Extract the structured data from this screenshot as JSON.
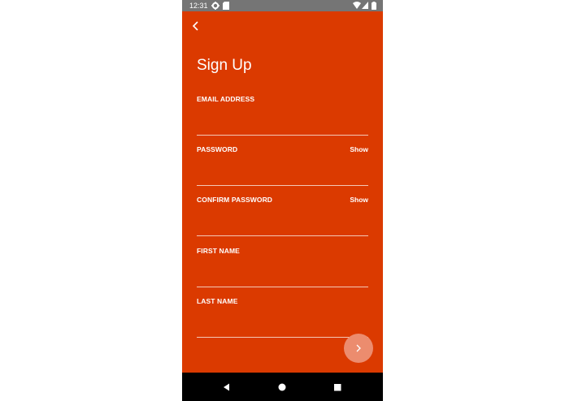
{
  "status_bar": {
    "time": "12:31",
    "icons": [
      "gear-icon",
      "sd-card-icon",
      "wifi-icon",
      "signal-icon",
      "battery-icon"
    ]
  },
  "header": {
    "back_icon": "chevron-left-icon",
    "title": "Sign Up"
  },
  "form": {
    "email": {
      "label": "EMAIL ADDRESS",
      "value": ""
    },
    "password": {
      "label": "PASSWORD",
      "value": "",
      "toggle_label": "Show"
    },
    "confirm_password": {
      "label": "CONFIRM PASSWORD",
      "value": "",
      "toggle_label": "Show"
    },
    "first_name": {
      "label": "FIRST NAME",
      "value": ""
    },
    "last_name": {
      "label": "LAST NAME",
      "value": ""
    }
  },
  "fab": {
    "icon": "chevron-right-icon"
  },
  "nav_bar": {
    "icons": [
      "back-triangle-icon",
      "home-circle-icon",
      "recents-square-icon"
    ]
  },
  "colors": {
    "screen_background": "#db3a00",
    "status_bar": "#757575",
    "nav_bar": "#000000",
    "fab": "#ec8c6e",
    "text": "#ffffff"
  }
}
